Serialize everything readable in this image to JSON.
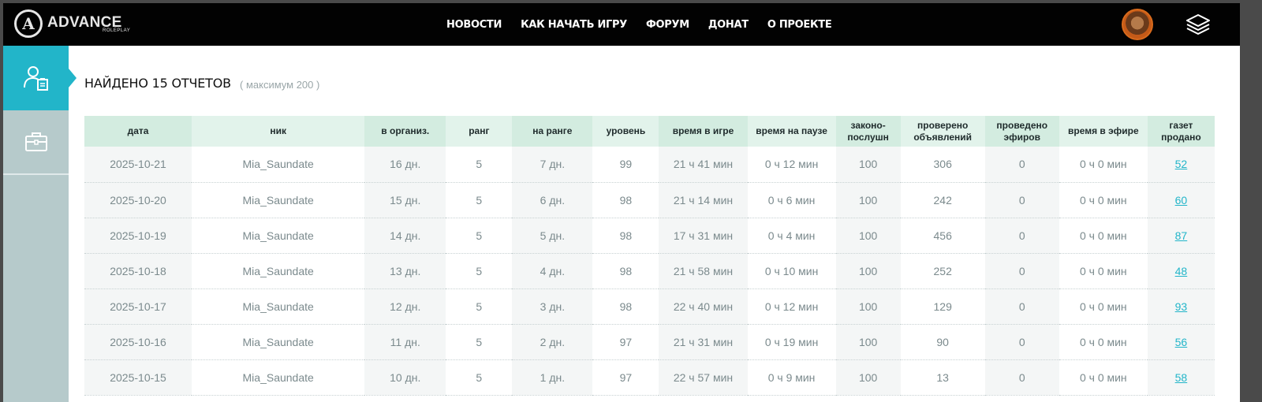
{
  "header": {
    "logo": {
      "title": "ADVANCE",
      "subtitle": "ROLEPLAY"
    },
    "nav": [
      "НОВОСТИ",
      "КАК НАЧАТЬ ИГРУ",
      "ФОРУМ",
      "ДОНАТ",
      "О ПРОЕКТЕ"
    ],
    "icons": {
      "user": "avatar",
      "menu": "layers-icon"
    }
  },
  "sidebar": {
    "items": [
      {
        "icon": "user-report-icon",
        "active": true
      },
      {
        "icon": "briefcase-icon",
        "active": false
      }
    ]
  },
  "main": {
    "heading": "НАЙДЕНО 15 ОТЧЕТОВ",
    "subheading": "( максимум 200 )"
  },
  "table": {
    "columns": [
      "дата",
      "ник",
      "в организ.",
      "ранг",
      "на ранге",
      "уровень",
      "время в игре",
      "время на паузе",
      "законо-\nпослушн",
      "проверено\nобъявлений",
      "проведено\nэфиров",
      "время в эфире",
      "газет\nпродано"
    ],
    "rows": [
      [
        "2025-10-21",
        "Mia_Saundate",
        "16 дн.",
        "5",
        "7 дн.",
        "99",
        "21 ч 41 мин",
        "0 ч 12 мин",
        "100",
        "306",
        "0",
        "0 ч 0 мин",
        "52"
      ],
      [
        "2025-10-20",
        "Mia_Saundate",
        "15 дн.",
        "5",
        "6 дн.",
        "98",
        "21 ч 14 мин",
        "0 ч 6 мин",
        "100",
        "242",
        "0",
        "0 ч 0 мин",
        "60"
      ],
      [
        "2025-10-19",
        "Mia_Saundate",
        "14 дн.",
        "5",
        "5 дн.",
        "98",
        "17 ч 31 мин",
        "0 ч 4 мин",
        "100",
        "456",
        "0",
        "0 ч 0 мин",
        "87"
      ],
      [
        "2025-10-18",
        "Mia_Saundate",
        "13 дн.",
        "5",
        "4 дн.",
        "98",
        "21 ч 58 мин",
        "0 ч 10 мин",
        "100",
        "252",
        "0",
        "0 ч 0 мин",
        "48"
      ],
      [
        "2025-10-17",
        "Mia_Saundate",
        "12 дн.",
        "5",
        "3 дн.",
        "98",
        "22 ч 40 мин",
        "0 ч 12 мин",
        "100",
        "129",
        "0",
        "0 ч 0 мин",
        "93"
      ],
      [
        "2025-10-16",
        "Mia_Saundate",
        "11 дн.",
        "5",
        "2 дн.",
        "97",
        "21 ч 31 мин",
        "0 ч 19 мин",
        "100",
        "90",
        "0",
        "0 ч 0 мин",
        "56"
      ],
      [
        "2025-10-15",
        "Mia_Saundate",
        "10 дн.",
        "5",
        "1 дн.",
        "97",
        "22 ч 57 мин",
        "0 ч 9 мин",
        "100",
        "13",
        "0",
        "0 ч 0 мин",
        "58"
      ]
    ]
  },
  "colors": {
    "accent": "#22b5c9",
    "topbar": "#020202",
    "sidebar": "#b6cacb",
    "header_row": "#e2f3eb",
    "cell_text": "#7b8a8d"
  }
}
